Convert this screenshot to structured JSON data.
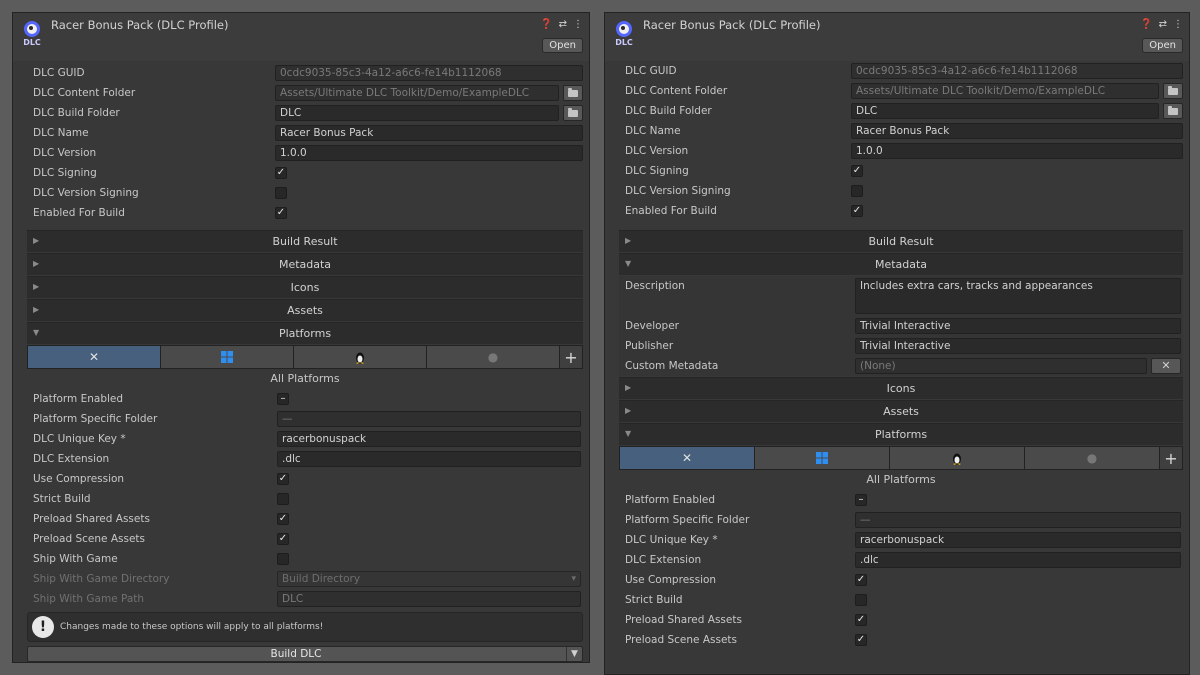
{
  "window": {
    "title": "Racer Bonus Pack (DLC Profile)",
    "open_label": "Open",
    "header_icons": [
      "help-icon",
      "presets-icon",
      "more-icon"
    ]
  },
  "profile": {
    "guid_label": "DLC GUID",
    "guid_value": "0cdc9035-85c3-4a12-a6c6-fe14b1112068",
    "content_folder_label": "DLC Content Folder",
    "content_folder_value": "Assets/Ultimate DLC Toolkit/Demo/ExampleDLC",
    "build_folder_label": "DLC Build Folder",
    "build_folder_value": "DLC",
    "name_label": "DLC Name",
    "name_value": "Racer Bonus Pack",
    "version_label": "DLC Version",
    "version_value": "1.0.0",
    "signing_label": "DLC Signing",
    "signing_checked": true,
    "version_signing_label": "DLC Version Signing",
    "version_signing_checked": false,
    "enabled_for_build_label": "Enabled For Build",
    "enabled_for_build_checked": true
  },
  "sections": {
    "build_result": "Build Result",
    "metadata": "Metadata",
    "icons": "Icons",
    "assets": "Assets",
    "platforms": "Platforms"
  },
  "metadata": {
    "description_label": "Description",
    "description_value": "Includes extra cars, tracks and appearances",
    "developer_label": "Developer",
    "developer_value": "Trivial Interactive",
    "publisher_label": "Publisher",
    "publisher_value": "Trivial Interactive",
    "custom_label": "Custom Metadata",
    "custom_value": "(None)"
  },
  "platforms": {
    "tabs": [
      "tools-icon",
      "windows-icon",
      "linux-icon",
      "apple-icon"
    ],
    "add_label": "+",
    "all_platforms": "All Platforms",
    "enabled_label": "Platform Enabled",
    "enabled_value": "–",
    "specific_folder_label": "Platform Specific Folder",
    "specific_folder_value": "—",
    "unique_key_label": "DLC Unique Key *",
    "unique_key_value": "racerbonuspack",
    "extension_label": "DLC Extension",
    "extension_value": ".dlc",
    "compression_label": "Use Compression",
    "compression_checked": true,
    "strict_label": "Strict Build",
    "strict_checked": false,
    "preload_shared_label": "Preload Shared Assets",
    "preload_shared_checked": true,
    "preload_scene_label": "Preload Scene Assets",
    "preload_scene_checked": true,
    "ship_label": "Ship With Game",
    "ship_checked": false,
    "ship_dir_label": "Ship With Game Directory",
    "ship_dir_value": "Build Directory",
    "ship_path_label": "Ship With Game Path",
    "ship_path_value": "DLC",
    "info_text": "Changes made to these options will apply to all platforms!"
  },
  "build_button": "Build DLC",
  "check_glyph": "✓"
}
